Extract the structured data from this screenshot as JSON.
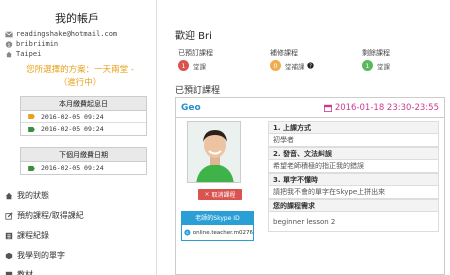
{
  "sidebar": {
    "title": "我的帳戶",
    "email": "readingshake@hotmail.com",
    "skype": "bribriimin",
    "city": "Taipei",
    "plan_line1": "您所選擇的方案：一天兩堂 -",
    "plan_line2": "（進行中）",
    "start_panel": {
      "title": "本月繳費起息日",
      "rows": [
        "2016-02-05 09:24",
        "2016-02-05 09:24"
      ]
    },
    "next_panel": {
      "title": "下個月繳費日期",
      "rows": [
        "2016-02-05 09:24"
      ]
    },
    "menu": [
      "我的狀態",
      "預約課程/取得課紀",
      "課程紀錄",
      "我學到的單字",
      "教材"
    ]
  },
  "main": {
    "welcome": "歡迎 Bri",
    "stats": [
      {
        "label": "已預訂課程",
        "count": "1",
        "unit": "堂課",
        "color": "#d9534f"
      },
      {
        "label": "補修課程",
        "count": "0",
        "unit": "堂補課",
        "color": "#f0ad4e"
      },
      {
        "label": "剩餘課程",
        "count": "1",
        "unit": "堂課",
        "color": "#5cb85c"
      }
    ],
    "booked_title": "已預訂課程",
    "card": {
      "course": "Geo",
      "datetime": "2016-01-18 23:30-23:55",
      "cancel_label": "取消課程",
      "skype_title": "老師的Skype ID",
      "teacher_skype": "online.teacher.m0276",
      "qa": [
        {
          "q": "1. 上課方式",
          "a": "初學者"
        },
        {
          "q": "2. 發音、文法糾誤",
          "a": "希望老師積極的指正我的錯誤"
        },
        {
          "q": "3. 單字不懂時",
          "a": "請把我不會的單字在Skype上拼出來"
        },
        {
          "q": "您的課程需求",
          "a": "beginner lesson 2"
        }
      ]
    }
  },
  "colors": {
    "accent_blue": "#2a9fd6",
    "plan_orange": "#e8a21a",
    "date_pink": "#cc3a8f",
    "cancel_red": "#d9534f"
  }
}
